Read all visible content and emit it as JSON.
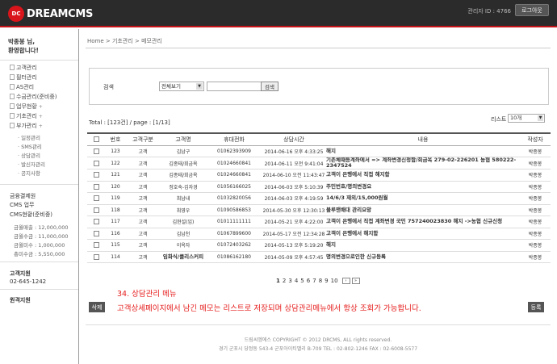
{
  "header": {
    "logo_mark": "DC",
    "logo_text": "DREAMCMS",
    "admin_id": "관리자 ID : 4766",
    "logout_label": "로그아웃"
  },
  "sidebar": {
    "greeting_line1": "박종봉 님,",
    "greeting_line2": "환영합니다!",
    "menu": [
      {
        "label": "고객관리",
        "expandable": false
      },
      {
        "label": "필터관리",
        "expandable": false
      },
      {
        "label": "AS관리",
        "expandable": false
      },
      {
        "label": "수금관리(준비중)",
        "expandable": false
      },
      {
        "label": "업무현황",
        "expandable": true
      },
      {
        "label": "기초관리",
        "expandable": true
      },
      {
        "label": "부가관리",
        "expandable": true
      }
    ],
    "submenu": [
      "일정관리",
      "SMS관리",
      "상담관리",
      "발신자관리",
      "공지사항"
    ],
    "finance_title": "금융결제원",
    "cms_business": "CMS 업무",
    "cms_status": "CMS현황(준비중)",
    "stats": [
      "금월매출 : 12,000,000",
      "금월수금 : 11,000,000",
      "금월미수 : 1,000,000",
      "총미수금 : 5,550,000"
    ],
    "support_title": "고객지원",
    "support_phone": "02-645-1242",
    "remote_title": "원격지원"
  },
  "breadcrumb": "Home  >  기초관리  >  메모관리",
  "search": {
    "label": "검색",
    "select_value": "전체보기",
    "input_value": "",
    "button_label": "검색"
  },
  "listing": {
    "total_text": "Total : [123건] / page : [1/13]",
    "list_label": "리스트",
    "list_select_value": "10개"
  },
  "table": {
    "columns": [
      "",
      "번호",
      "고객구분",
      "고객명",
      "휴대전화",
      "상담시간",
      "내용",
      "작성자"
    ],
    "rows": [
      {
        "no": "123",
        "type": "고객",
        "name": "김남구",
        "phone": "01062393909",
        "time": "2014-06-16 오후 4:33:25",
        "content": "해지",
        "writer": "박종봉"
      },
      {
        "no": "122",
        "type": "고객",
        "name": "김종태/회금옥",
        "phone": "01024660841",
        "time": "2014-06-11 오전 9:41:04",
        "content": "기존체때등계좌에서 => 계좌변경신청함/회금옥 279-02-226201 농협 580222-2347524",
        "writer": "박종봉"
      },
      {
        "no": "121",
        "type": "고객",
        "name": "김종태/회금옥",
        "phone": "01024660841",
        "time": "2014-06-10 오전 11:43:47",
        "content": "고객이 은행에서 직접 해지함",
        "writer": "박종봉"
      },
      {
        "no": "120",
        "type": "고객",
        "name": "정호숙-김자경",
        "phone": "01056166025",
        "time": "2014-06-03 오후 5:10:39",
        "content": "주민번호/명의변경요",
        "writer": "박종봉"
      },
      {
        "no": "119",
        "type": "고객",
        "name": "최남내",
        "phone": "01032820056",
        "time": "2014-06-03 오후 4:19:59",
        "content": "14/6/3 재외/15,000원월",
        "writer": "박종봉"
      },
      {
        "no": "118",
        "type": "고객",
        "name": "최영우",
        "phone": "01090586853",
        "time": "2014-05-30 오후 12:30:13",
        "content": "블루맨배대 관리요망",
        "writer": "박종봉"
      },
      {
        "no": "117",
        "type": "고객",
        "name": "김현설(임)",
        "phone": "01011111111",
        "time": "2014-05-21 오후 4:22:00",
        "content": "고객이 은행에서 직접 계좌변경 국민 757240023830 해지 ->농협 신규신청",
        "writer": "박종봉"
      },
      {
        "no": "116",
        "type": "고객",
        "name": "김남천",
        "phone": "01067899600",
        "time": "2014-05-17 오전 12:34:28",
        "content": "고객이 은행에서 해지함",
        "writer": "박종봉"
      },
      {
        "no": "115",
        "type": "고객",
        "name": "이옥자",
        "phone": "01072403262",
        "time": "2014-05-13 오후 5:19:20",
        "content": "해지",
        "writer": "박종봉"
      },
      {
        "no": "114",
        "type": "고객",
        "name": "임화식/클리스커피",
        "phone": "01086162180",
        "time": "2014-05-09 오후 4:57:45",
        "content": "명의변경으로인한 신규등록",
        "writer": "박종봉"
      }
    ]
  },
  "pagination": {
    "pages": [
      "1",
      "2",
      "3",
      "4",
      "5",
      "6",
      "7",
      "8",
      "9",
      "10"
    ],
    "current": "1",
    "next_label": "›",
    "last_label": "»"
  },
  "actions": {
    "delete_label": "삭제",
    "register_label": "등록"
  },
  "annotation": {
    "title": "34. 상담관리 메뉴",
    "body": "고객상세페이지에서 남긴 메모는 리스트로 저장되며 상담관리메뉴에서 항상 조회가 가능합니다."
  },
  "footer": {
    "line1": "드림씨엠에스 COPYRIGHT © 2012 DRCMS, ALL rights reserved.",
    "line2": "경기 군포시 당정동 543-4 군포아이티밸리 B-709   TEL : 02-802-1246   FAX : 02-6008-5577"
  },
  "colors": {
    "topbar": "#2b2b2b",
    "accent_red": "#d9151b",
    "annotation_red": "#e61c1c"
  }
}
